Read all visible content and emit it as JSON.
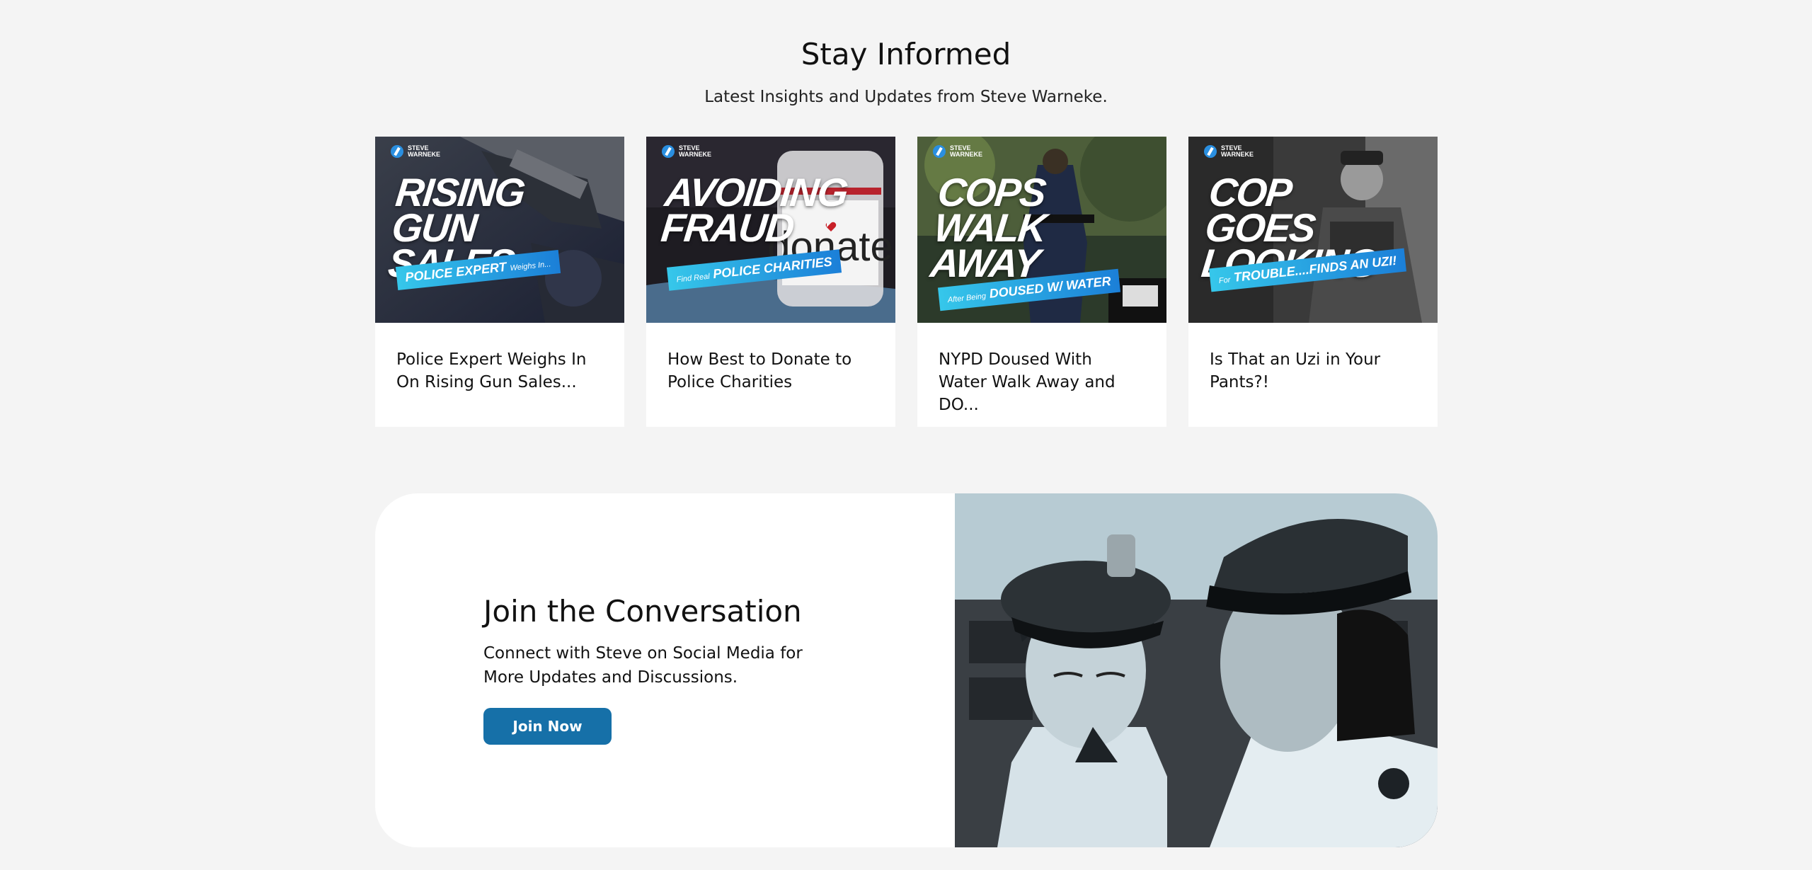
{
  "header": {
    "title": "Stay Informed",
    "subtitle": "Latest Insights and Updates from Steve Warneke."
  },
  "brand": {
    "line1": "STEVE",
    "line2": "WARNEKE"
  },
  "cards": [
    {
      "headline": "RISING GUN SALES",
      "ribbon": "POLICE EXPERT",
      "ribbon_small": "Weighs In...",
      "title": "Police Expert Weighs In On Rising Gun Sales..."
    },
    {
      "headline": "AVOIDING FRAUD",
      "ribbon": "POLICE CHARITIES",
      "ribbon_small": "Find Real",
      "jar_label": "donate",
      "title": "How Best to Donate to Police Charities"
    },
    {
      "headline": "COPS WALK AWAY",
      "ribbon": "DOUSED W/ WATER",
      "ribbon_small": "After Being",
      "title": "NYPD Doused With Water Walk Away and DO..."
    },
    {
      "headline": "COP GOES LOOKING",
      "ribbon": "TROUBLE....FINDS AN UZI!",
      "ribbon_small": "For",
      "title": "Is That an Uzi in Your Pants?!"
    }
  ],
  "join": {
    "title": "Join the Conversation",
    "description": "Connect with Steve on Social Media for More Updates and Discussions.",
    "button_label": "Join Now"
  },
  "colors": {
    "background": "#f4f4f4",
    "button": "#1670a8",
    "ribbon_start": "#36c7ea",
    "ribbon_end": "#1b7fd8"
  }
}
